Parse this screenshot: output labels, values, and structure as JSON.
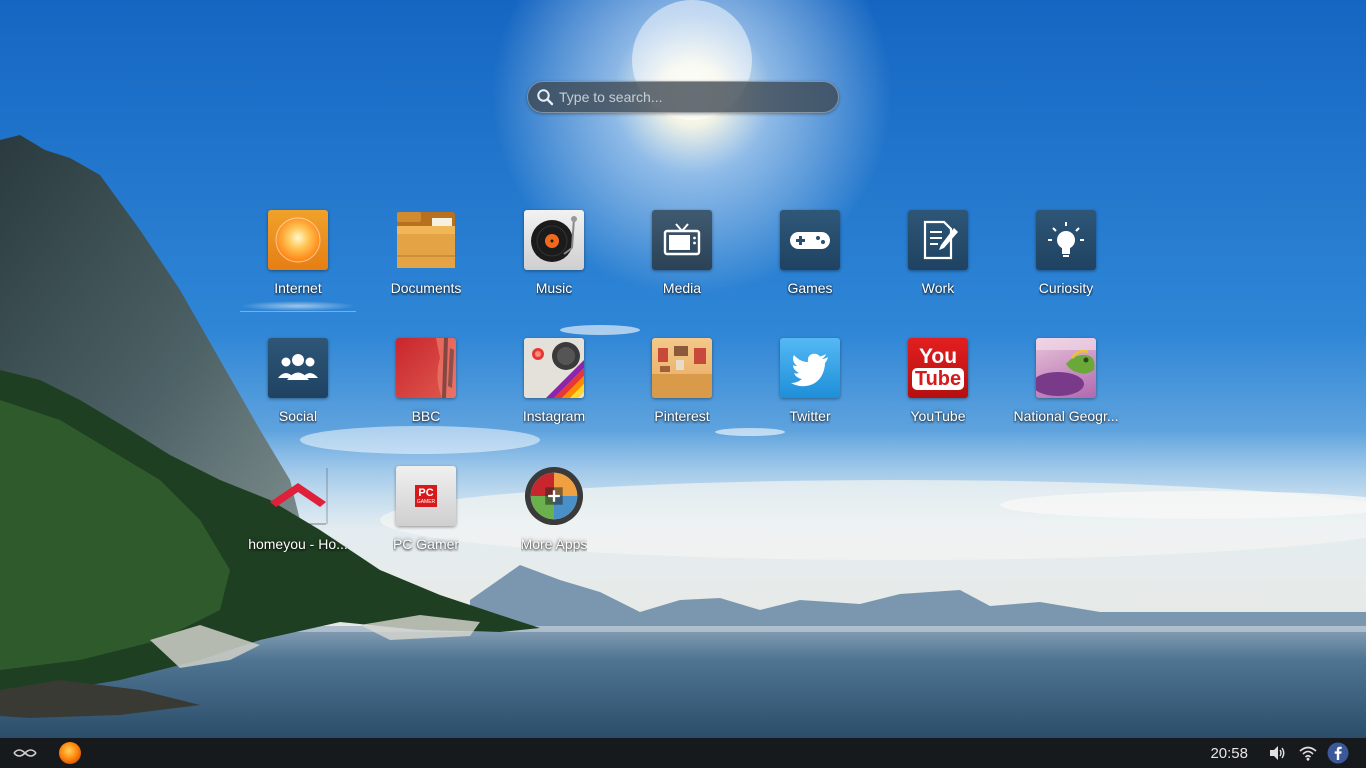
{
  "search": {
    "placeholder": "Type to search...",
    "icon": "search-icon"
  },
  "apps": [
    {
      "id": "internet",
      "label": "Internet",
      "icon": "sun-browser-icon",
      "selected": true
    },
    {
      "id": "documents",
      "label": "Documents",
      "icon": "folder-icon"
    },
    {
      "id": "music",
      "label": "Music",
      "icon": "turntable-icon"
    },
    {
      "id": "media",
      "label": "Media",
      "icon": "tv-icon"
    },
    {
      "id": "games",
      "label": "Games",
      "icon": "gamepad-icon"
    },
    {
      "id": "work",
      "label": "Work",
      "icon": "document-pen-icon"
    },
    {
      "id": "curiosity",
      "label": "Curiosity",
      "icon": "lightbulb-icon"
    },
    {
      "id": "social",
      "label": "Social",
      "icon": "people-icon"
    },
    {
      "id": "bbc",
      "label": "BBC",
      "icon": "bbc-icon"
    },
    {
      "id": "instagram",
      "label": "Instagram",
      "icon": "camera-icon"
    },
    {
      "id": "pinterest",
      "label": "Pinterest",
      "icon": "pinterest-gallery-icon"
    },
    {
      "id": "twitter",
      "label": "Twitter",
      "icon": "twitter-bird-icon"
    },
    {
      "id": "youtube",
      "label": "YouTube",
      "icon": "youtube-icon",
      "logo_text": [
        "You",
        "Tube"
      ]
    },
    {
      "id": "natgeo",
      "label": "National Geogr...",
      "icon": "chameleon-icon"
    },
    {
      "id": "homeyou",
      "label": "homeyou - Ho...",
      "icon": "roof-icon"
    },
    {
      "id": "pcgamer",
      "label": "PC Gamer",
      "icon": "pc-gamer-icon",
      "logo_text": [
        "PC",
        "GAMER"
      ]
    },
    {
      "id": "moreapps",
      "label": "More Apps",
      "icon": "add-apps-icon"
    }
  ],
  "taskbar": {
    "clock": "20:58",
    "left_icons": [
      "endless-logo-icon",
      "browser-orb-icon"
    ],
    "right_icons": [
      "volume-icon",
      "wifi-icon",
      "facebook-icon"
    ]
  },
  "colors": {
    "sky_top": "#1565c0",
    "sky_mid": "#3a8fd8",
    "taskbar": "#161a1d",
    "youtube_red": "#d6191a",
    "twitter_blue": "#1da1f2",
    "facebook_blue": "#3b5998"
  }
}
